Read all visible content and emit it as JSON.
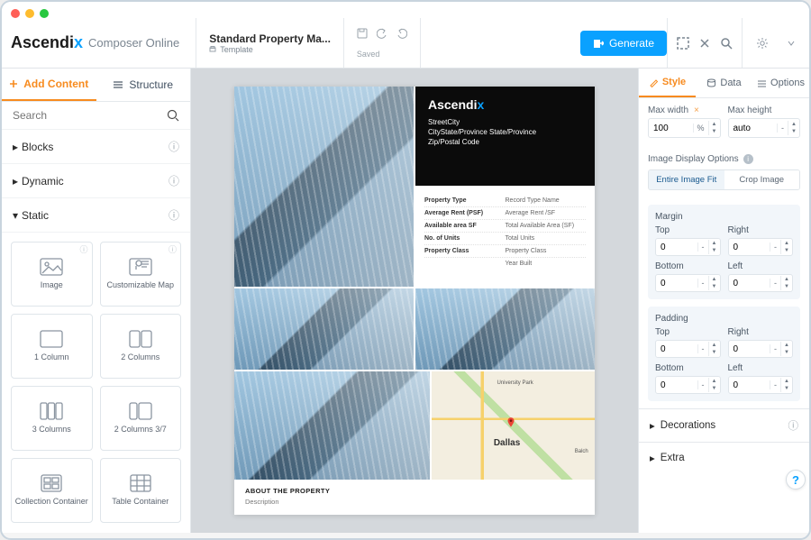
{
  "brand": {
    "name": "Ascendi",
    "accent": "x",
    "product": "Composer Online"
  },
  "document": {
    "title": "Standard Property Ma...",
    "type_label": "Template",
    "saved_label": "Saved"
  },
  "header": {
    "generate": "Generate"
  },
  "left": {
    "tabs": {
      "add": "Add Content",
      "structure": "Structure"
    },
    "search_placeholder": "Search",
    "cats": {
      "blocks": "Blocks",
      "dynamic": "Dynamic",
      "static": "Static"
    },
    "tiles": [
      "Image",
      "Customizable Map",
      "1 Column",
      "2 Columns",
      "3 Columns",
      "2 Columns 3/7",
      "Collection Container",
      "Table Container"
    ]
  },
  "canvas": {
    "overlay": {
      "logo": "Ascendi",
      "accent": "x",
      "l1": "StreetCity",
      "l2": "CityState/Province State/Province",
      "l3": "Zip/Postal Code"
    },
    "facts": [
      {
        "k": "Property Type",
        "v": "Record Type Name"
      },
      {
        "k": "Average Rent (PSF)",
        "v": "Average Rent /SF"
      },
      {
        "k": "Available area SF",
        "v": "Total Available Area (SF)"
      },
      {
        "k": "No. of Units",
        "v": "Total Units"
      },
      {
        "k": "Property Class",
        "v": "Property Class"
      },
      {
        "k": "",
        "v": "Year Built"
      }
    ],
    "map": {
      "city": "Dallas",
      "l1": "University Park",
      "l2": "Balch"
    },
    "about": {
      "h": "ABOUT THE PROPERTY",
      "d": "Description"
    }
  },
  "right": {
    "tabs": {
      "style": "Style",
      "data": "Data",
      "options": "Options"
    },
    "maxw": {
      "label": "Max width",
      "value": "100",
      "unit": "%"
    },
    "maxh": {
      "label": "Max height",
      "value": "auto"
    },
    "ido": {
      "label": "Image Display Options",
      "fit": "Entire Image Fit",
      "crop": "Crop Image"
    },
    "margin": {
      "title": "Margin",
      "top": "Top",
      "right": "Right",
      "bottom": "Bottom",
      "left": "Left",
      "v": "0",
      "u": "-"
    },
    "padding": {
      "title": "Padding",
      "top": "Top",
      "right": "Right",
      "bottom": "Bottom",
      "left": "Left",
      "v": "0",
      "u": "-"
    },
    "decor": "Decorations",
    "extra": "Extra"
  },
  "help": "?"
}
